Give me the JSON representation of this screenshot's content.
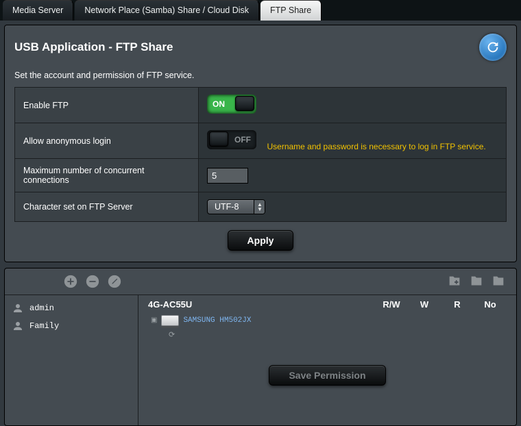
{
  "tabs": {
    "media": "Media Server",
    "samba": "Network Place (Samba) Share / Cloud Disk",
    "ftp": "FTP Share"
  },
  "page": {
    "title": "USB Application - FTP Share",
    "subtitle": "Set the account and permission of FTP service."
  },
  "settings": {
    "enable_ftp_label": "Enable FTP",
    "enable_ftp_on": "ON",
    "allow_anon_label": "Allow anonymous login",
    "allow_anon_off": "OFF",
    "allow_anon_hint": "Username and password is necessary to log in FTP service.",
    "max_conn_label": "Maximum number of concurrent connections",
    "max_conn_value": "5",
    "charset_label": "Character set on FTP Server",
    "charset_value": "UTF-8"
  },
  "buttons": {
    "apply": "Apply",
    "save_permission": "Save Permission"
  },
  "users": {
    "admin": "admin",
    "family": "Family"
  },
  "share": {
    "device": "4G-AC55U",
    "col_rw": "R/W",
    "col_w": "W",
    "col_r": "R",
    "col_no": "No",
    "disk_name": "SAMSUNG HM502JX"
  }
}
